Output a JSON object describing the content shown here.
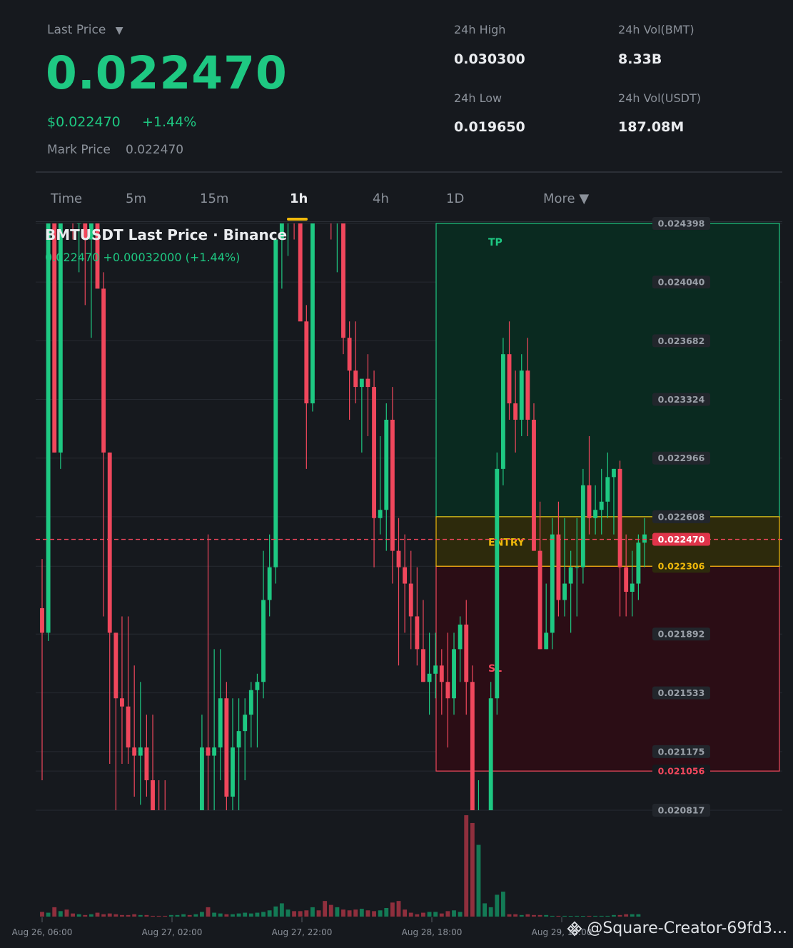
{
  "header": {
    "last_price_label": "Last Price",
    "last_price_caret": "▼",
    "last_price": "0.022470",
    "usd_price": "$0.022470",
    "change_pct": "+1.44%",
    "mark_label": "Mark Price",
    "mark_value": "0.022470",
    "stats": [
      {
        "label": "24h High",
        "value": "0.030300"
      },
      {
        "label": "24h Vol(BMT)",
        "value": "8.33B"
      },
      {
        "label": "24h Low",
        "value": "0.019650"
      },
      {
        "label": "24h Vol(USDT)",
        "value": "187.08M"
      }
    ]
  },
  "tabs": [
    {
      "label": "Time",
      "active": false
    },
    {
      "label": "5m",
      "active": false
    },
    {
      "label": "15m",
      "active": false
    },
    {
      "label": "1h",
      "active": true
    },
    {
      "label": "4h",
      "active": false
    },
    {
      "label": "1D",
      "active": false
    },
    {
      "label": "More ▼",
      "active": false
    }
  ],
  "colors": {
    "up": "#1ec882",
    "down": "#f0475c",
    "accent": "#f0b90b",
    "tp_zone": "#0a2a20",
    "sl_zone": "#2b0d15",
    "entry_zone": "#2d2a0c"
  },
  "chart_data": {
    "type": "candlestick",
    "title": "BMTUSDT Last Price · Binance",
    "subtitle": "0.022470  +0.00032000 (+1.44%)",
    "y_axis_ticks": [
      "0.024398",
      "0.024040",
      "0.023682",
      "0.023324",
      "0.022966",
      "0.022608",
      "0.022306",
      "0.021892",
      "0.021533",
      "0.021175",
      "0.021056",
      "0.020817"
    ],
    "ylim": [
      0.020817,
      0.024398
    ],
    "last_price": 0.02247,
    "last_price_label": "0.022470",
    "zones": {
      "tp_label": "TP",
      "entry_label": "ENTRY",
      "sl_label": "SL",
      "tp": 0.024398,
      "entry_top": 0.022608,
      "entry_bottom": 0.022306,
      "sl": 0.021056
    },
    "x_axis_labels": [
      "Aug 26, 06:00",
      "Aug 27, 02:00",
      "Aug 27, 22:00",
      "Aug 28, 18:00",
      "Aug 29, 14:00"
    ],
    "candles": [
      [
        0.02205,
        0.02235,
        0.021,
        0.0219
      ],
      [
        0.0219,
        0.02495,
        0.02185,
        0.0246
      ],
      [
        0.0246,
        0.0246,
        0.023,
        0.023
      ],
      [
        0.023,
        0.0256,
        0.0229,
        0.0252
      ],
      [
        0.0252,
        0.0255,
        0.0244,
        0.0247
      ],
      [
        0.0247,
        0.0253,
        0.0243,
        0.0244
      ],
      [
        0.0244,
        0.025,
        0.0241,
        0.0244
      ],
      [
        0.0244,
        0.0249,
        0.0239,
        0.0243
      ],
      [
        0.0243,
        0.02485,
        0.0237,
        0.0245
      ],
      [
        0.0245,
        0.0253,
        0.0242,
        0.024
      ],
      [
        0.024,
        0.0241,
        0.022,
        0.023
      ],
      [
        0.023,
        0.023,
        0.0211,
        0.0219
      ],
      [
        0.0219,
        0.0219,
        0.0208,
        0.0215
      ],
      [
        0.0215,
        0.022,
        0.0211,
        0.02145
      ],
      [
        0.02145,
        0.022,
        0.0211,
        0.0212
      ],
      [
        0.0212,
        0.0217,
        0.0209,
        0.02115
      ],
      [
        0.02115,
        0.0216,
        0.02085,
        0.0212
      ],
      [
        0.0212,
        0.0214,
        0.0209,
        0.021
      ],
      [
        0.021,
        0.0214,
        0.0208,
        0.0207
      ],
      [
        0.0207,
        0.021,
        0.0205,
        0.0203
      ],
      [
        0.0203,
        0.021,
        0.0204,
        0.0202
      ],
      [
        0.0202,
        0.0207,
        0.0201,
        0.0203
      ],
      [
        0.0203,
        0.0206,
        0.0201,
        0.0204
      ],
      [
        0.0204,
        0.0207,
        0.0204,
        0.0205
      ],
      [
        0.0205,
        0.0206,
        0.0203,
        0.02045
      ],
      [
        0.02045,
        0.0208,
        0.0204,
        0.0208
      ],
      [
        0.0208,
        0.0214,
        0.0207,
        0.0212
      ],
      [
        0.0212,
        0.0225,
        0.0208,
        0.02115
      ],
      [
        0.02115,
        0.0218,
        0.0208,
        0.0212
      ],
      [
        0.0212,
        0.0218,
        0.021,
        0.0215
      ],
      [
        0.0215,
        0.0216,
        0.0208,
        0.0209
      ],
      [
        0.0209,
        0.0215,
        0.0208,
        0.0212
      ],
      [
        0.0212,
        0.0215,
        0.0208,
        0.0213
      ],
      [
        0.0213,
        0.0215,
        0.021,
        0.0214
      ],
      [
        0.0214,
        0.0216,
        0.0212,
        0.02155
      ],
      [
        0.02155,
        0.02165,
        0.0212,
        0.0216
      ],
      [
        0.0216,
        0.0224,
        0.0215,
        0.0221
      ],
      [
        0.0221,
        0.0225,
        0.022,
        0.0223
      ],
      [
        0.0223,
        0.0243,
        0.0222,
        0.0243
      ],
      [
        0.0243,
        0.0248,
        0.024,
        0.0246
      ],
      [
        0.0246,
        0.025,
        0.0242,
        0.0246
      ],
      [
        0.0246,
        0.0249,
        0.0243,
        0.0245
      ],
      [
        0.0245,
        0.0248,
        0.024,
        0.0238
      ],
      [
        0.0238,
        0.0239,
        0.0229,
        0.0233
      ],
      [
        0.0233,
        0.025,
        0.02325,
        0.0249
      ],
      [
        0.0249,
        0.0252,
        0.0244,
        0.0247
      ],
      [
        0.0247,
        0.0251,
        0.0244,
        0.0246
      ],
      [
        0.0246,
        0.025,
        0.0243,
        0.0245
      ],
      [
        0.0245,
        0.0248,
        0.0241,
        0.0246
      ],
      [
        0.0246,
        0.0248,
        0.0236,
        0.0237
      ],
      [
        0.0237,
        0.0238,
        0.0232,
        0.0235
      ],
      [
        0.0235,
        0.0238,
        0.0233,
        0.0234
      ],
      [
        0.0234,
        0.0234,
        0.023,
        0.02345
      ],
      [
        0.02345,
        0.0236,
        0.0231,
        0.0234
      ],
      [
        0.0234,
        0.0235,
        0.0223,
        0.0226
      ],
      [
        0.0226,
        0.0231,
        0.0225,
        0.02265
      ],
      [
        0.02265,
        0.0233,
        0.0224,
        0.0232
      ],
      [
        0.0232,
        0.0234,
        0.0222,
        0.0224
      ],
      [
        0.0224,
        0.0226,
        0.0217,
        0.0223
      ],
      [
        0.0223,
        0.0225,
        0.0219,
        0.0222
      ],
      [
        0.0222,
        0.0224,
        0.0218,
        0.022
      ],
      [
        0.022,
        0.0223,
        0.0217,
        0.0218
      ],
      [
        0.0218,
        0.0221,
        0.0216,
        0.0216
      ],
      [
        0.0216,
        0.0219,
        0.0214,
        0.02165
      ],
      [
        0.02165,
        0.0219,
        0.0215,
        0.0217
      ],
      [
        0.0217,
        0.0218,
        0.0214,
        0.0216
      ],
      [
        0.0216,
        0.0219,
        0.0212,
        0.0215
      ],
      [
        0.0215,
        0.0219,
        0.0214,
        0.0218
      ],
      [
        0.0218,
        0.022,
        0.0216,
        0.02195
      ],
      [
        0.02195,
        0.0221,
        0.0214,
        0.0216
      ],
      [
        0.0216,
        0.0217,
        0.0205,
        0.0204
      ],
      [
        0.0204,
        0.021,
        0.0203,
        0.0206
      ],
      [
        0.0206,
        0.0208,
        0.0205,
        0.02075
      ],
      [
        0.02075,
        0.0216,
        0.0207,
        0.0215
      ],
      [
        0.0215,
        0.023,
        0.0214,
        0.0229
      ],
      [
        0.0229,
        0.0237,
        0.0228,
        0.0236
      ],
      [
        0.0236,
        0.0238,
        0.0232,
        0.0233
      ],
      [
        0.0233,
        0.0235,
        0.023,
        0.0232
      ],
      [
        0.0232,
        0.0236,
        0.0231,
        0.0235
      ],
      [
        0.0235,
        0.0237,
        0.0231,
        0.0232
      ],
      [
        0.0232,
        0.0233,
        0.0224,
        0.0224
      ],
      [
        0.0224,
        0.0227,
        0.0218,
        0.0218
      ],
      [
        0.0218,
        0.0222,
        0.0218,
        0.0219
      ],
      [
        0.0219,
        0.0226,
        0.0218,
        0.0225
      ],
      [
        0.0225,
        0.0227,
        0.022,
        0.0221
      ],
      [
        0.0221,
        0.0226,
        0.022,
        0.0222
      ],
      [
        0.0222,
        0.0224,
        0.0219,
        0.0223
      ],
      [
        0.0223,
        0.0226,
        0.022,
        0.0223
      ],
      [
        0.0223,
        0.0229,
        0.0222,
        0.0228
      ],
      [
        0.0228,
        0.0231,
        0.0225,
        0.0226
      ],
      [
        0.0226,
        0.0228,
        0.0225,
        0.02265
      ],
      [
        0.02265,
        0.0229,
        0.0225,
        0.0227
      ],
      [
        0.0227,
        0.023,
        0.0226,
        0.02285
      ],
      [
        0.02285,
        0.0229,
        0.0225,
        0.0229
      ],
      [
        0.0229,
        0.02295,
        0.022,
        0.0223
      ],
      [
        0.0223,
        0.0225,
        0.022,
        0.02215
      ],
      [
        0.02215,
        0.0224,
        0.022,
        0.0222
      ],
      [
        0.0222,
        0.0225,
        0.0221,
        0.02245
      ],
      [
        0.02245,
        0.0226,
        0.0223,
        0.0225
      ]
    ],
    "volumes": [
      6,
      5,
      12,
      7,
      9,
      4,
      3,
      2,
      3,
      5,
      3,
      4,
      3,
      2,
      2,
      3,
      2,
      2,
      1,
      1,
      1,
      2,
      2,
      3,
      2,
      3,
      6,
      12,
      5,
      4,
      3,
      3,
      4,
      5,
      4,
      5,
      6,
      8,
      13,
      17,
      9,
      7,
      7,
      8,
      12,
      8,
      20,
      15,
      12,
      9,
      8,
      9,
      10,
      8,
      7,
      8,
      11,
      18,
      20,
      9,
      5,
      3,
      5,
      6,
      6,
      4,
      7,
      8,
      6,
      130,
      120,
      92,
      17,
      12,
      28,
      32,
      3,
      3,
      2,
      3,
      2,
      2,
      2,
      1,
      1,
      1,
      0,
      1,
      0,
      1,
      1,
      1,
      1,
      2,
      2,
      3,
      3,
      3
    ]
  },
  "watermark": {
    "text": "@Square-Creator-69fd3..."
  }
}
